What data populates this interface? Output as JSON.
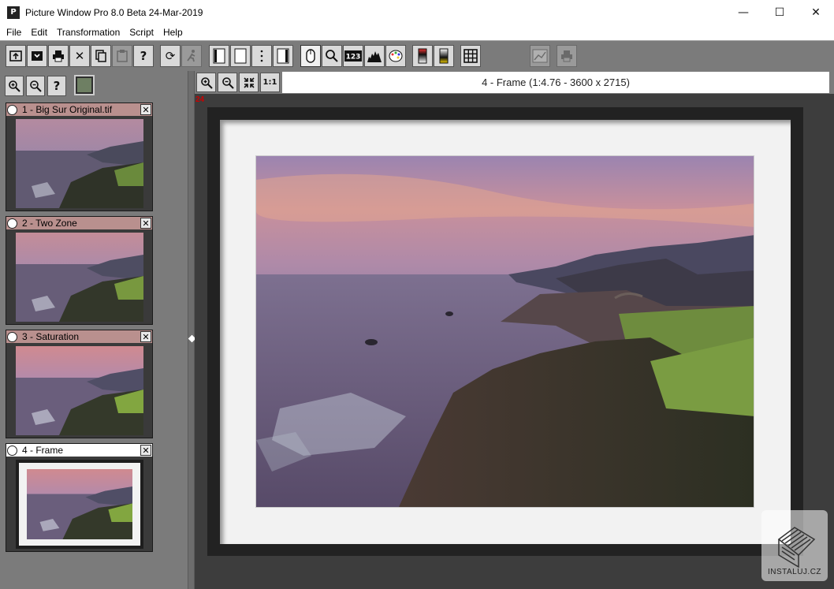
{
  "window": {
    "title": "Picture Window Pro 8.0 Beta 24-Mar-2019",
    "app_icon": "P",
    "minimize": "—",
    "maximize": "☐",
    "close": "✕"
  },
  "menu": {
    "file": "File",
    "edit": "Edit",
    "transformation": "Transformation",
    "script": "Script",
    "help": "Help"
  },
  "left_panel": {
    "thumbnails": [
      {
        "title": "1 - Big Sur Original.tif",
        "close": "✕",
        "header_color": "#b9908e"
      },
      {
        "title": "2 - Two Zone",
        "close": "✕",
        "header_color": "#b9908e"
      },
      {
        "title": "3 - Saturation",
        "close": "✕",
        "header_color": "#b9908e"
      },
      {
        "title": "4 - Frame",
        "close": "✕",
        "header_color": "#ffffff"
      }
    ]
  },
  "main": {
    "zoom_actual": "1:1",
    "frame_title": "4 - Frame (1:4.76 - 3600 x 2715)",
    "zoom_marker": "24"
  },
  "watermark": {
    "text": "INSTALUJ.CZ"
  }
}
